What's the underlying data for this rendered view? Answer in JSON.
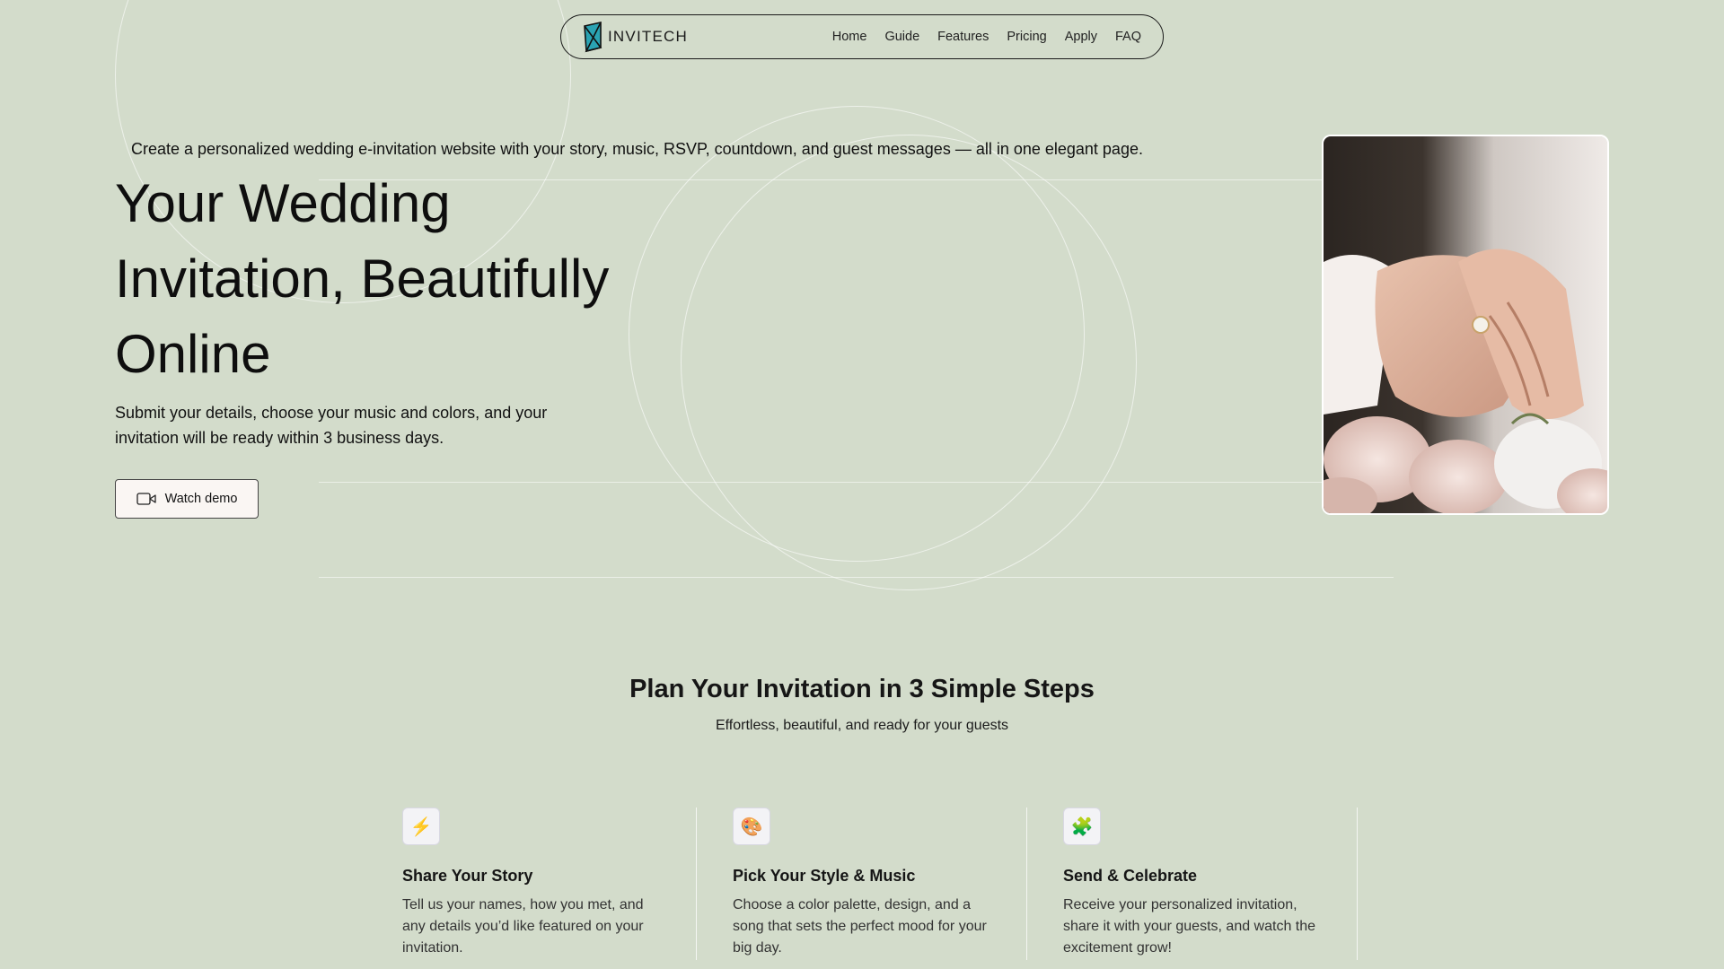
{
  "nav": {
    "logo_text": "INVITECH",
    "links": [
      "Home",
      "Guide",
      "Features",
      "Pricing",
      "Apply",
      "FAQ"
    ]
  },
  "hero": {
    "tagline": "Create a personalized wedding e-invitation website with your story, music, RSVP, countdown, and guest messages — all in one elegant page.",
    "title_lines": [
      "Your Wedding",
      "Invitation, Beautifully",
      "Online"
    ],
    "subtitle": "Submit your details, choose your music and colors, and your invitation will be ready within 3 business days.",
    "demo_button": "Watch demo",
    "photo_icon": "wedding-hands-ring-photo"
  },
  "steps": {
    "title": "Plan Your Invitation in 3 Simple Steps",
    "subtitle": "Effortless, beautiful, and ready for your guests",
    "items": [
      {
        "icon": "⚡",
        "icon_name": "lightning-icon",
        "title": "Share Your Story",
        "desc": "Tell us your names, how you met, and any details you’d like featured on your invitation."
      },
      {
        "icon": "🎨",
        "icon_name": "palette-icon",
        "title": "Pick Your Style & Music",
        "desc": "Choose a color palette, design, and a song that sets the perfect mood for your big day."
      },
      {
        "icon": "🧩",
        "icon_name": "puzzle-icon",
        "title": "Send & Celebrate",
        "desc": "Receive your personalized invitation, share it with your guests, and watch the excitement grow!"
      }
    ]
  },
  "colors": {
    "background": "#d3dccb",
    "accent_teal": "#2aa3b3",
    "text": "#111111"
  }
}
